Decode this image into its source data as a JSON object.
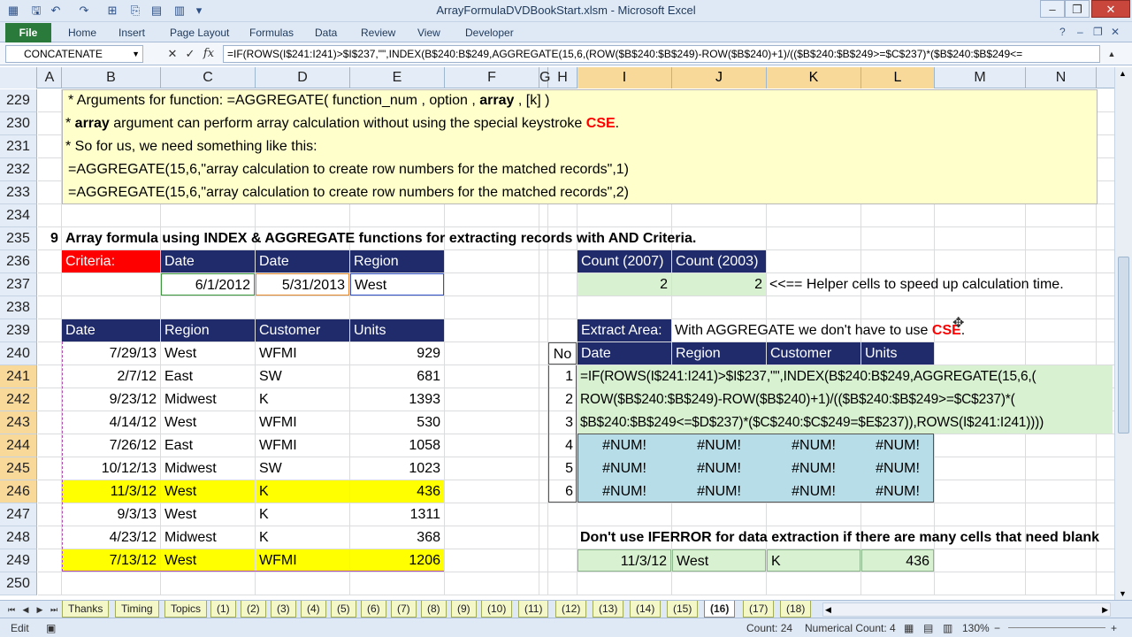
{
  "window": {
    "title": "ArrayFormulaDVDBookStart.xlsm - Microsoft Excel"
  },
  "ribbon": {
    "file": "File",
    "tabs": [
      "Home",
      "Insert",
      "Page Layout",
      "Formulas",
      "Data",
      "Review",
      "View",
      "Developer"
    ]
  },
  "formula_bar": {
    "name_box": "CONCATENATE",
    "formula": "=IF(ROWS(I$241:I241)>$I$237,\"\",INDEX(B$240:B$249,AGGREGATE(15,6,(ROW($B$240:$B$249)-ROW($B$240)+1)/(($B$240:$B$249>=$C$237)*($B$240:$B$249<="
  },
  "columns": [
    "A",
    "B",
    "C",
    "D",
    "E",
    "F",
    "G",
    "H",
    "I",
    "J",
    "K",
    "L",
    "M",
    "N"
  ],
  "rows": [
    "229",
    "230",
    "231",
    "232",
    "233",
    "234",
    "235",
    "236",
    "237",
    "238",
    "239",
    "240",
    "241",
    "242",
    "243",
    "244",
    "245",
    "246",
    "247",
    "248",
    "249",
    "250"
  ],
  "notes": {
    "line1_prefix": "* Arguments for function: =AGGREGATE( function_num , option , ",
    "line1_bold": "array",
    "line1_suffix": " , [k] )",
    "line2_prefix": "* ",
    "line2_bold": "array",
    "line2_mid": " argument can perform array calculation without using the special keystroke ",
    "line2_red": "CSE",
    "line2_end": ".",
    "line3": "* So for us, we need something like this:",
    "line4": "=AGGREGATE(15,6,\"array calculation to create row numbers for the matched records\",1)",
    "line5": "=AGGREGATE(15,6,\"array calculation to create row numbers for the matched records\",2)"
  },
  "section": {
    "number": "9",
    "heading": "Array formula using INDEX & AGGREGATE functions for extracting records with AND Criteria."
  },
  "criteria": {
    "label": "Criteria:",
    "headers": [
      "Date",
      "Date",
      "Region"
    ],
    "values": [
      "6/1/2012",
      "5/31/2013",
      "West"
    ]
  },
  "data_table": {
    "headers": [
      "Date",
      "Region",
      "Customer",
      "Units"
    ],
    "rows": [
      [
        "7/29/13",
        "West",
        "WFMI",
        "929"
      ],
      [
        "2/7/12",
        "East",
        "SW",
        "681"
      ],
      [
        "9/23/12",
        "Midwest",
        "K",
        "1393"
      ],
      [
        "4/14/12",
        "West",
        "WFMI",
        "530"
      ],
      [
        "7/26/12",
        "East",
        "WFMI",
        "1058"
      ],
      [
        "10/12/13",
        "Midwest",
        "SW",
        "1023"
      ],
      [
        "11/3/12",
        "West",
        "K",
        "436"
      ],
      [
        "9/3/13",
        "West",
        "K",
        "1311"
      ],
      [
        "4/23/12",
        "Midwest",
        "K",
        "368"
      ],
      [
        "7/13/12",
        "West",
        "WFMI",
        "1206"
      ]
    ]
  },
  "helper": {
    "headers": [
      "Count (2007)",
      "Count (2003)"
    ],
    "values": [
      "2",
      "2"
    ],
    "note": "<<== Helper cells to speed up calculation time."
  },
  "extract": {
    "label": "Extract Area:",
    "note_prefix": "With AGGREGATE we don't have to use ",
    "note_red": "CSE",
    "note_end": ".",
    "no_header": "No",
    "headers": [
      "Date",
      "Region",
      "Customer",
      "Units"
    ],
    "numbers": [
      "1",
      "2",
      "3",
      "4",
      "5",
      "6"
    ],
    "formula_line1": "=IF(ROWS(I$241:I241)>$I$237,\"\",INDEX(B$240:B$249,AGGREGATE(15,6,(",
    "formula_line2": "ROW($B$240:$B$249)-ROW($B$240)+1)/(($B$240:$B$249>=$C$237)*(",
    "formula_line3": "$B$240:$B$249<=$D$237)*($C$240:$C$249=$E$237)),ROWS(I$241:I241))))",
    "error": "#NUM!"
  },
  "warning": {
    "text": "Don't use IFERROR for data extraction if there are many cells that need blank",
    "row": [
      "11/3/12",
      "West",
      "K",
      "436"
    ]
  },
  "sheet_tabs": [
    "Thanks",
    "Timing",
    "Topics",
    "(1)",
    "(2)",
    "(3)",
    "(4)",
    "(5)",
    "(6)",
    "(7)",
    "(8)",
    "(9)",
    "(10)",
    "(11)",
    "(12)",
    "(13)",
    "(14)",
    "(15)",
    "(16)",
    "(17)",
    "(18)"
  ],
  "active_sheet": "(16)",
  "status": {
    "mode": "Edit",
    "count": "Count: 24",
    "numerical_count": "Numerical Count: 4",
    "zoom": "130%"
  }
}
